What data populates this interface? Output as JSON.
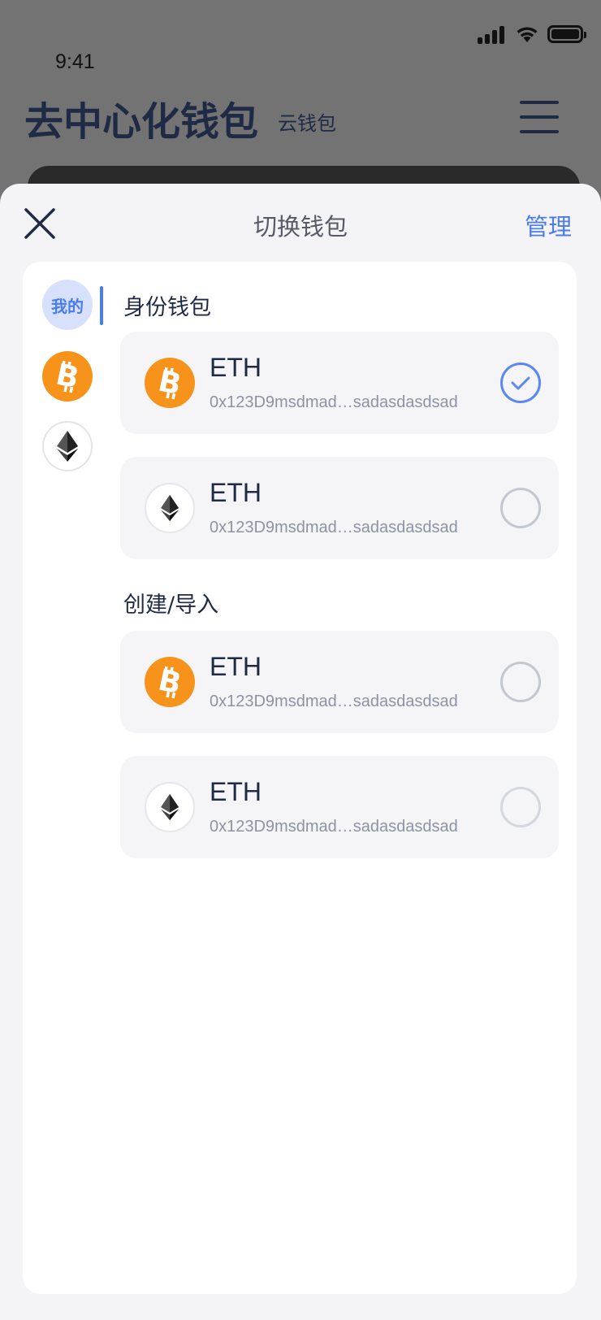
{
  "status_bar": {
    "time": "9:41"
  },
  "app": {
    "title": "去中心化钱包",
    "subtitle": "云钱包"
  },
  "sheet": {
    "title": "切换钱包",
    "manage_label": "管理"
  },
  "categories": [
    {
      "label": "我的",
      "active": true
    },
    {
      "icon": "bitcoin-icon"
    },
    {
      "icon": "ethereum-icon"
    }
  ],
  "sections": [
    {
      "title": "身份钱包",
      "wallets": [
        {
          "name": "ETH",
          "address": "0x123D9msdmad…sadasdasdsad",
          "icon": "bitcoin-icon",
          "selected": true
        },
        {
          "name": "ETH",
          "address": "0x123D9msdmad…sadasdasdsad",
          "icon": "ethereum-icon",
          "selected": false
        }
      ]
    },
    {
      "title": "创建/导入",
      "wallets": [
        {
          "name": "ETH",
          "address": "0x123D9msdmad…sadasdasdsad",
          "icon": "bitcoin-icon",
          "selected": false
        },
        {
          "name": "ETH",
          "address": "0x123D9msdmad…sadasdasdsad",
          "icon": "ethereum-icon",
          "selected": false
        }
      ]
    }
  ],
  "colors": {
    "accent": "#4a7cf0",
    "bitcoin": "#f7931a",
    "text": "#1f2a44",
    "muted": "#8c93a3"
  }
}
